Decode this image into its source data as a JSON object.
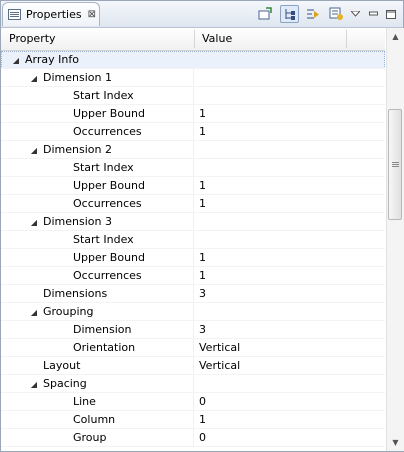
{
  "view": {
    "tab_label": "Properties",
    "tab_close": "⊠",
    "toolbar_icons": [
      "pin-icon",
      "tree-view-icon",
      "filter-icon",
      "advanced-icon",
      "view-menu-icon",
      "minimize-icon",
      "maximize-icon"
    ]
  },
  "columns": {
    "property": "Property",
    "value": "Value"
  },
  "rows": [
    {
      "level": 0,
      "toggle": "◢",
      "label": "Array Info",
      "value": "",
      "selected": true
    },
    {
      "level": 1,
      "toggle": "◢",
      "label": "Dimension 1",
      "value": ""
    },
    {
      "level": 2,
      "toggle": "",
      "label": "Start Index",
      "value": ""
    },
    {
      "level": 2,
      "toggle": "",
      "label": "Upper Bound",
      "value": "1"
    },
    {
      "level": 2,
      "toggle": "",
      "label": "Occurrences",
      "value": "1"
    },
    {
      "level": 1,
      "toggle": "◢",
      "label": "Dimension 2",
      "value": ""
    },
    {
      "level": 2,
      "toggle": "",
      "label": "Start Index",
      "value": ""
    },
    {
      "level": 2,
      "toggle": "",
      "label": "Upper Bound",
      "value": "1"
    },
    {
      "level": 2,
      "toggle": "",
      "label": "Occurrences",
      "value": "1"
    },
    {
      "level": 1,
      "toggle": "◢",
      "label": "Dimension 3",
      "value": ""
    },
    {
      "level": 2,
      "toggle": "",
      "label": "Start Index",
      "value": ""
    },
    {
      "level": 2,
      "toggle": "",
      "label": "Upper Bound",
      "value": "1"
    },
    {
      "level": 2,
      "toggle": "",
      "label": "Occurrences",
      "value": "1"
    },
    {
      "level": 1,
      "toggle": "",
      "label": "Dimensions",
      "value": "3"
    },
    {
      "level": 1,
      "toggle": "◢",
      "label": "Grouping",
      "value": ""
    },
    {
      "level": 2,
      "toggle": "",
      "label": "Dimension",
      "value": "3"
    },
    {
      "level": 2,
      "toggle": "",
      "label": "Orientation",
      "value": "Vertical"
    },
    {
      "level": 1,
      "toggle": "",
      "label": "Layout",
      "value": "Vertical"
    },
    {
      "level": 1,
      "toggle": "◢",
      "label": "Spacing",
      "value": ""
    },
    {
      "level": 2,
      "toggle": "",
      "label": "Line",
      "value": "0"
    },
    {
      "level": 2,
      "toggle": "",
      "label": "Column",
      "value": "1"
    },
    {
      "level": 2,
      "toggle": "",
      "label": "Group",
      "value": "0"
    }
  ],
  "scrollbar": {
    "up": "▲",
    "down": "▼",
    "position": 0.23
  }
}
